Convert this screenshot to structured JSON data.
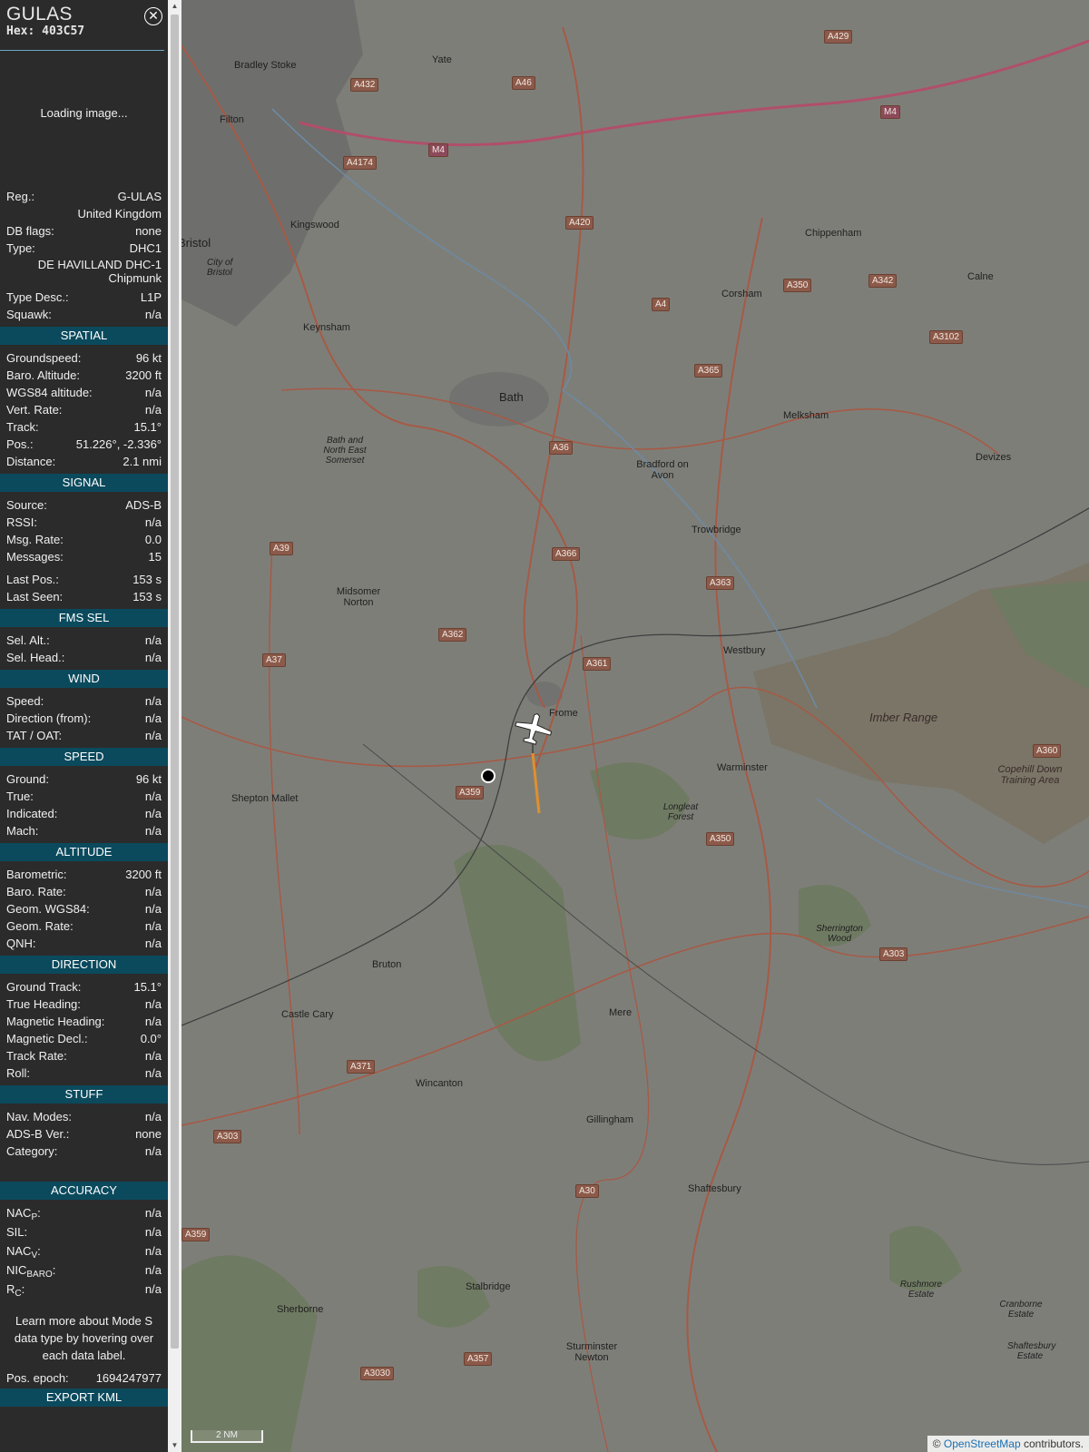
{
  "header": {
    "callsign": "GULAS",
    "hex": "Hex: 403C57"
  },
  "image": {
    "loading": "Loading image..."
  },
  "info": {
    "reg_label": "Reg.:",
    "reg": "G-ULAS",
    "country": "United Kingdom",
    "dbflags_label": "DB flags:",
    "dbflags": "none",
    "type_label": "Type:",
    "type": "DHC1",
    "type_full": "DE HAVILLAND DHC-1 Chipmunk",
    "typedesc_label": "Type Desc.:",
    "typedesc": "L1P",
    "squawk_label": "Squawk:",
    "squawk": "n/a"
  },
  "spatial": {
    "title": "SPATIAL",
    "rows": [
      {
        "label": "Groundspeed:",
        "value": "96 kt"
      },
      {
        "label": "Baro. Altitude:",
        "value": "3200 ft"
      },
      {
        "label": "WGS84 altitude:",
        "value": "n/a"
      },
      {
        "label": "Vert. Rate:",
        "value": "n/a"
      },
      {
        "label": "Track:",
        "value": "15.1°"
      },
      {
        "label": "Pos.:",
        "value": "51.226°, -2.336°"
      },
      {
        "label": "Distance:",
        "value": "2.1 nmi"
      }
    ]
  },
  "signal": {
    "title": "SIGNAL",
    "rows": [
      {
        "label": "Source:",
        "value": "ADS-B"
      },
      {
        "label": "RSSI:",
        "value": "n/a"
      },
      {
        "label": "Msg. Rate:",
        "value": "0.0"
      },
      {
        "label": "Messages:",
        "value": "15"
      }
    ],
    "rows2": [
      {
        "label": "Last Pos.:",
        "value": "153 s"
      },
      {
        "label": "Last Seen:",
        "value": "153 s"
      }
    ]
  },
  "fms": {
    "title": "FMS SEL",
    "rows": [
      {
        "label": "Sel. Alt.:",
        "value": "n/a"
      },
      {
        "label": "Sel. Head.:",
        "value": "n/a"
      }
    ]
  },
  "wind": {
    "title": "WIND",
    "rows": [
      {
        "label": "Speed:",
        "value": "n/a"
      },
      {
        "label": "Direction (from):",
        "value": "n/a"
      },
      {
        "label": "TAT / OAT:",
        "value": "n/a"
      }
    ]
  },
  "speed": {
    "title": "SPEED",
    "rows": [
      {
        "label": "Ground:",
        "value": "96 kt"
      },
      {
        "label": "True:",
        "value": "n/a"
      },
      {
        "label": "Indicated:",
        "value": "n/a"
      },
      {
        "label": "Mach:",
        "value": "n/a"
      }
    ]
  },
  "altitude": {
    "title": "ALTITUDE",
    "rows": [
      {
        "label": "Barometric:",
        "value": "3200 ft"
      },
      {
        "label": "Baro. Rate:",
        "value": "n/a"
      },
      {
        "label": "Geom. WGS84:",
        "value": "n/a"
      },
      {
        "label": "Geom. Rate:",
        "value": "n/a"
      },
      {
        "label": "QNH:",
        "value": "n/a"
      }
    ]
  },
  "direction": {
    "title": "DIRECTION",
    "rows": [
      {
        "label": "Ground Track:",
        "value": "15.1°"
      },
      {
        "label": "True Heading:",
        "value": "n/a"
      },
      {
        "label": "Magnetic Heading:",
        "value": "n/a"
      },
      {
        "label": "Magnetic Decl.:",
        "value": "0.0°"
      },
      {
        "label": "Track Rate:",
        "value": "n/a"
      },
      {
        "label": "Roll:",
        "value": "n/a"
      }
    ]
  },
  "stuff": {
    "title": "STUFF",
    "rows": [
      {
        "label": "Nav. Modes:",
        "value": "n/a"
      },
      {
        "label": "ADS-B Ver.:",
        "value": "none"
      },
      {
        "label": "Category:",
        "value": "n/a"
      }
    ]
  },
  "accuracy": {
    "title": "ACCURACY",
    "nacp": {
      "base": "NAC",
      "sub": "P",
      "value": "n/a"
    },
    "sil": {
      "label": "SIL:",
      "value": "n/a"
    },
    "nacv": {
      "base": "NAC",
      "sub": "V",
      "value": "n/a"
    },
    "nicbaro": {
      "base": "NIC",
      "sub": "BARO",
      "value": "n/a"
    },
    "rc": {
      "base": "R",
      "sub": "C",
      "value": "n/a"
    }
  },
  "note": "Learn more about Mode S data type by hovering over each data label.",
  "epoch": {
    "label": "Pos. epoch:",
    "value": "1694247977"
  },
  "export": "EXPORT KML",
  "map": {
    "towns": [
      "Bradley Stoke",
      "Yate",
      "Filton",
      "Kingswood",
      "Bristol",
      "City of Bristol",
      "Keynsham",
      "Bath",
      "Bath and North East Somerset",
      "Chippenham",
      "Calne",
      "Corsham",
      "Melksham",
      "Bradford on Avon",
      "Devizes",
      "Trowbridge",
      "Midsomer Norton",
      "Westbury",
      "Frome",
      "Imber Range",
      "Warminster",
      "Copehill Down Training Area",
      "Shepton Mallet",
      "Longleat Forest",
      "Sherrington Wood",
      "Bruton",
      "Castle Cary",
      "Mere",
      "Wincanton",
      "Gillingham",
      "Shaftesbury",
      "Stalbridge",
      "Sherborne",
      "Sturminster Newton",
      "Rushmore Estate",
      "Cranborne Estate",
      "Shaftesbury Estate"
    ],
    "roads": [
      "A429",
      "A432",
      "A46",
      "M4",
      "A4174",
      "A420",
      "A342",
      "A350",
      "A4",
      "A3102",
      "A365",
      "A36",
      "A39",
      "A366",
      "A363",
      "A362",
      "A37",
      "A361",
      "A359",
      "A360",
      "A303",
      "A371",
      "A30",
      "A3030",
      "A357"
    ],
    "scale": "2 NM",
    "attribution_prefix": "©",
    "attribution_link": "OpenStreetMap",
    "attribution_suffix": "contributors."
  }
}
